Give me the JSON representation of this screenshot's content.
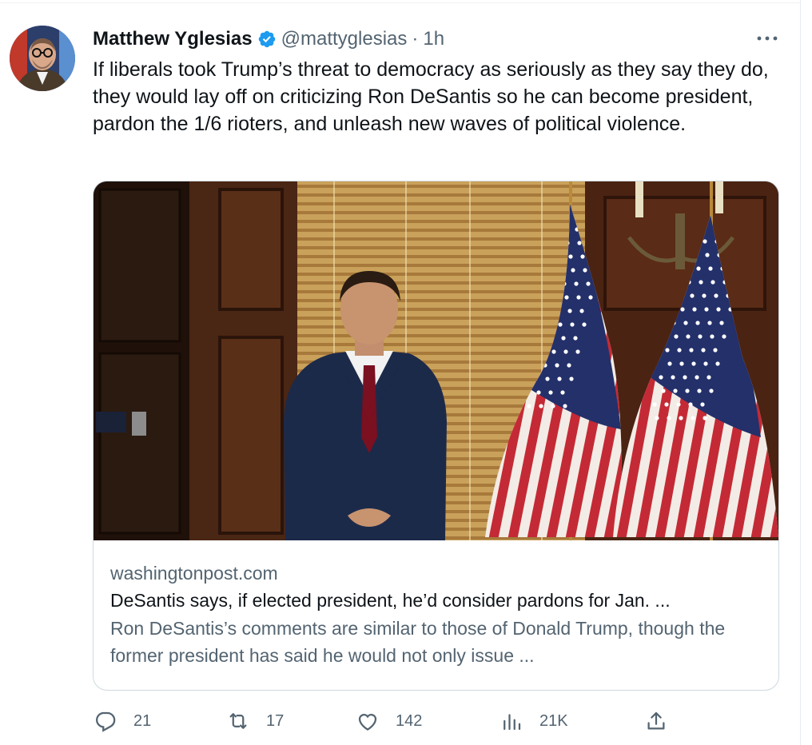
{
  "tweet": {
    "author_name": "Matthew Yglesias",
    "handle": "@mattyglesias",
    "separator": "·",
    "time": "1h",
    "text": "If liberals took Trump’s threat to democracy as seriously as they say they do, they would lay off on criticizing Ron DeSantis so he can become president, pardon the 1/6 rioters, and unleash new waves of political violence."
  },
  "card": {
    "domain": "washingtonpost.com",
    "title": "DeSantis says, if elected president, he’d consider pardons for Jan. ...",
    "description": "Ron DeSantis’s comments are similar to those of Donald Trump, though the former president has said he would not only issue ..."
  },
  "actions": {
    "reply": {
      "icon": "reply-icon",
      "count": "21"
    },
    "retweet": {
      "icon": "retweet-icon",
      "count": "17"
    },
    "like": {
      "icon": "heart-icon",
      "count": "142"
    },
    "views": {
      "icon": "views-icon",
      "count": "21K"
    },
    "share": {
      "icon": "share-icon"
    }
  },
  "colors": {
    "text": "#0f1419",
    "secondary": "#536471",
    "verified": "#1d9bf0",
    "border": "#cfd9de"
  }
}
